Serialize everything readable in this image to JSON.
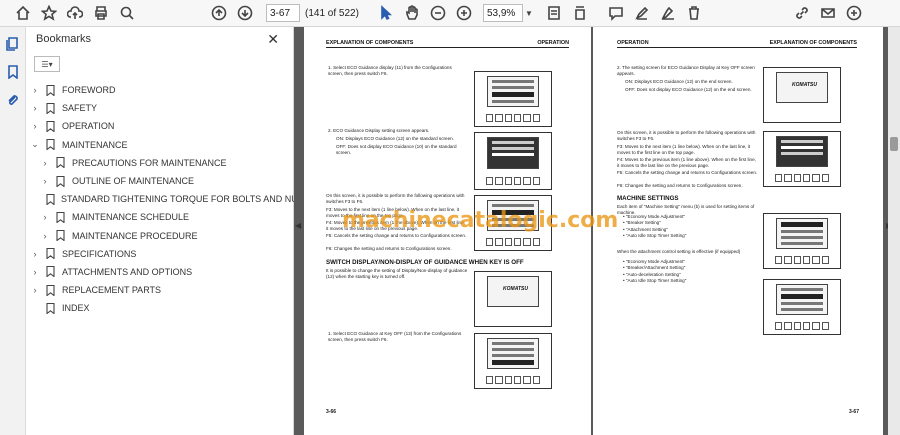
{
  "toolbar": {
    "page_current": "3-67",
    "page_of": "(141 of 522)",
    "zoom": "53,9%"
  },
  "bookmarks": {
    "title": "Bookmarks",
    "items": [
      {
        "label": "FOREWORD",
        "level": 0,
        "state": "collapsed"
      },
      {
        "label": "SAFETY",
        "level": 0,
        "state": "collapsed"
      },
      {
        "label": "OPERATION",
        "level": 0,
        "state": "collapsed"
      },
      {
        "label": "MAINTENANCE",
        "level": 0,
        "state": "expanded"
      },
      {
        "label": "PRECAUTIONS FOR MAINTENANCE",
        "level": 1,
        "state": "collapsed"
      },
      {
        "label": "OUTLINE OF MAINTENANCE",
        "level": 1,
        "state": "collapsed"
      },
      {
        "label": "STANDARD TIGHTENING TORQUE FOR BOLTS AND NUTS",
        "level": 1,
        "state": "leaf"
      },
      {
        "label": "MAINTENANCE SCHEDULE",
        "level": 1,
        "state": "collapsed"
      },
      {
        "label": "MAINTENANCE PROCEDURE",
        "level": 1,
        "state": "collapsed"
      },
      {
        "label": "SPECIFICATIONS",
        "level": 0,
        "state": "collapsed"
      },
      {
        "label": "ATTACHMENTS AND OPTIONS",
        "level": 0,
        "state": "collapsed"
      },
      {
        "label": "REPLACEMENT PARTS",
        "level": 0,
        "state": "collapsed"
      },
      {
        "label": "INDEX",
        "level": 0,
        "state": "leaf"
      }
    ]
  },
  "left_page": {
    "header_left": "EXPLANATION OF COMPONENTS",
    "header_right": "OPERATION",
    "step1": "1.    Select ECO Guidance display (11) from the Configurations screen, then press switch F6.",
    "step2": "2.    ECO Guidance Display setting screen appears.",
    "step2_on": "ON: Displays ECO Guidance (12) on the standard screen.",
    "step2_off": "OFF: Does not display ECO Guidance (10) on the standard screen.",
    "ops_intro": "On this screen, it is possible to perform the following operations with switches F3 to F6.",
    "f3": "F3: Moves to the next item (1 line below). When on the last line, it moves to the first line on the top page.",
    "f4": "F4: Moves to the previous item (1 line above). When on the first line, it moves to the last line on the previous page.",
    "f5": "F5: Cancels the setting change and returns to Configurations screen.",
    "f6": "F6: Changes the setting and returns to Configurations screen.",
    "section_title": "SWITCH DISPLAY/NON-DISPLAY OF GUIDANCE WHEN KEY IS OFF",
    "section_body": "It is possible to change the setting of Display/Non-display of guidance (12) when the starting key is turned off.",
    "step_b1": "1.    Select ECO Guidance at Key OFF (13) from the Configurations screen, then press switch F6.",
    "page_number": "3-66"
  },
  "right_page": {
    "header_left": "OPERATION",
    "header_right": "EXPLANATION OF COMPONENTS",
    "step2": "2.    The setting screen for ECO Guidance Display at Key OFF screen appears.",
    "step2_on": "ON: Displays ECO Guidance (12) on the end screen.",
    "step2_off": "OFF: Does not display ECO Guidance (12) on the end screen.",
    "ops_intro": "On this screen, it is possible to perform the following operations with switches F3 to F6.",
    "f3": "F3: Moves to the next item (1 line below). When on the last line, it moves to the first line on the top page.",
    "f4": "F4: Moves to the previous item (1 line above). When on the first line, it moves to the last line on the previous page.",
    "f5": "F5: Cancels the setting change and returns to Configurations screen.",
    "f6": "F6: Changes the setting and returns to Configurations screen.",
    "section_title": "MACHINE SETTINGS",
    "section_body": "Each item of \"Machine Setting\" menu (b) is used for setting items of machine.",
    "list1": [
      "\"Economy Mode Adjustment\"",
      "\"Breaker Setting\"",
      "\"Attachment Setting\"",
      "\"Auto Idle Stop Timer Setting\""
    ],
    "attach_note": "When the attachment control setting is effective (if equipped)",
    "list2": [
      "\"Economy Mode Adjustment\"",
      "\"Breaker/Attachment Setting\"",
      "\"Auto-deceleration Setting\"",
      "\"Auto Idle Stop Timer Setting\""
    ],
    "page_number": "3-67"
  },
  "figures": {
    "brand": "KOMATSU"
  },
  "watermark": "machinecatalogic.com"
}
